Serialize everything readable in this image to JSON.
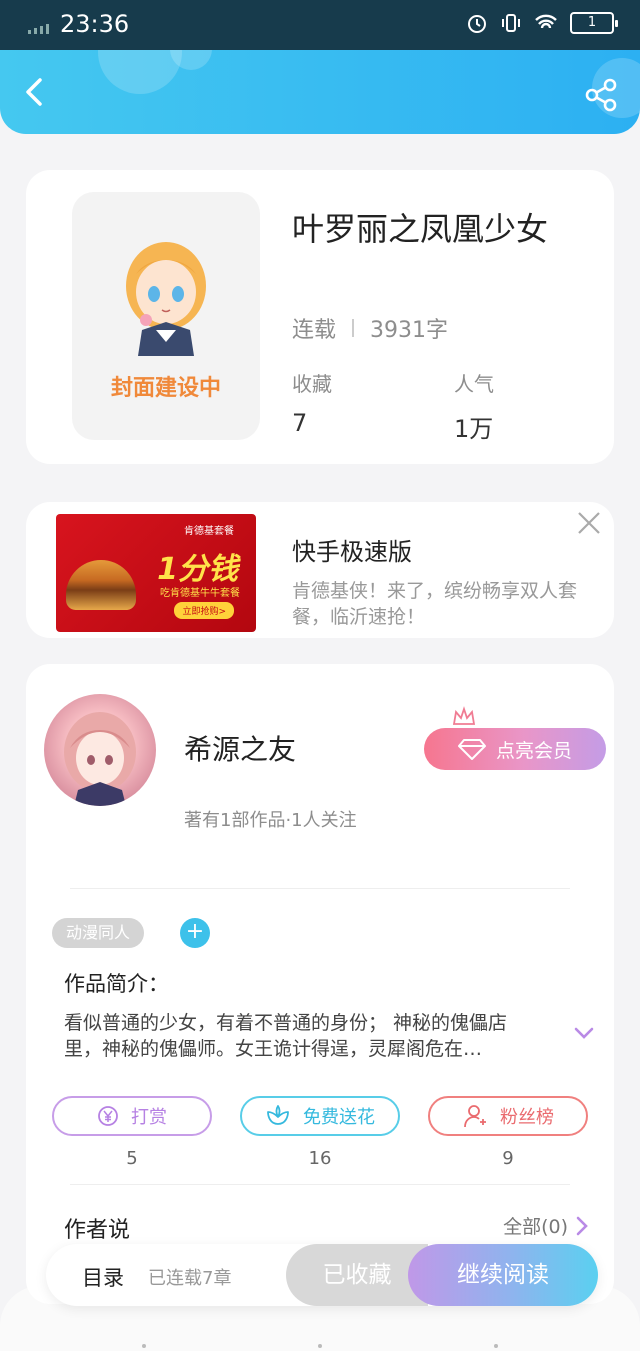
{
  "status_bar": {
    "time": "23:36",
    "battery": "1"
  },
  "book": {
    "cover_text": "封面建设中",
    "title": "叶罗丽之凤凰少女",
    "status": "连载",
    "word_count": "3931字",
    "favorites_label": "收藏",
    "favorites_value": "7",
    "popularity_label": "人气",
    "popularity_value": "1万"
  },
  "ad": {
    "image_text_top": "肯德基套餐",
    "image_text_big": "1分钱",
    "image_text_mid": "吃肯德基牛牛套餐",
    "image_button": "立即抢购>",
    "title": "快手极速版",
    "description": "肯德基侠！来了，缤纷畅享双人套餐，临沂速抢！"
  },
  "author": {
    "name": "希源之友",
    "meta": "著有1部作品·1人关注",
    "vip_label": "点亮会员",
    "tag": "动漫同人",
    "add_tag": "+",
    "intro_title": "作品简介：",
    "intro_text": "看似普通的少女，有着不普通的身份； 神秘的傀儡店里，神秘的傀儡师。女王诡计得逞，灵犀阁危在…",
    "actions": [
      {
        "label": "打赏",
        "count": "5",
        "icon": "yen-coin-icon"
      },
      {
        "label": "免费送花",
        "count": "16",
        "icon": "flower-icon"
      },
      {
        "label": "粉丝榜",
        "count": "9",
        "icon": "user-icon"
      }
    ],
    "author_says": "作者说",
    "all_link": "全部(0)"
  },
  "bottom_bar": {
    "toc": "目录",
    "toc_sub": "已连载7章",
    "collected": "已收藏",
    "continue": "继续阅读"
  },
  "colors": {
    "header": "#2cb0f2",
    "accent_cover": "#f0893a",
    "reward": "#b681e3",
    "flower": "#35b9de",
    "fans": "#ea6b6f"
  }
}
